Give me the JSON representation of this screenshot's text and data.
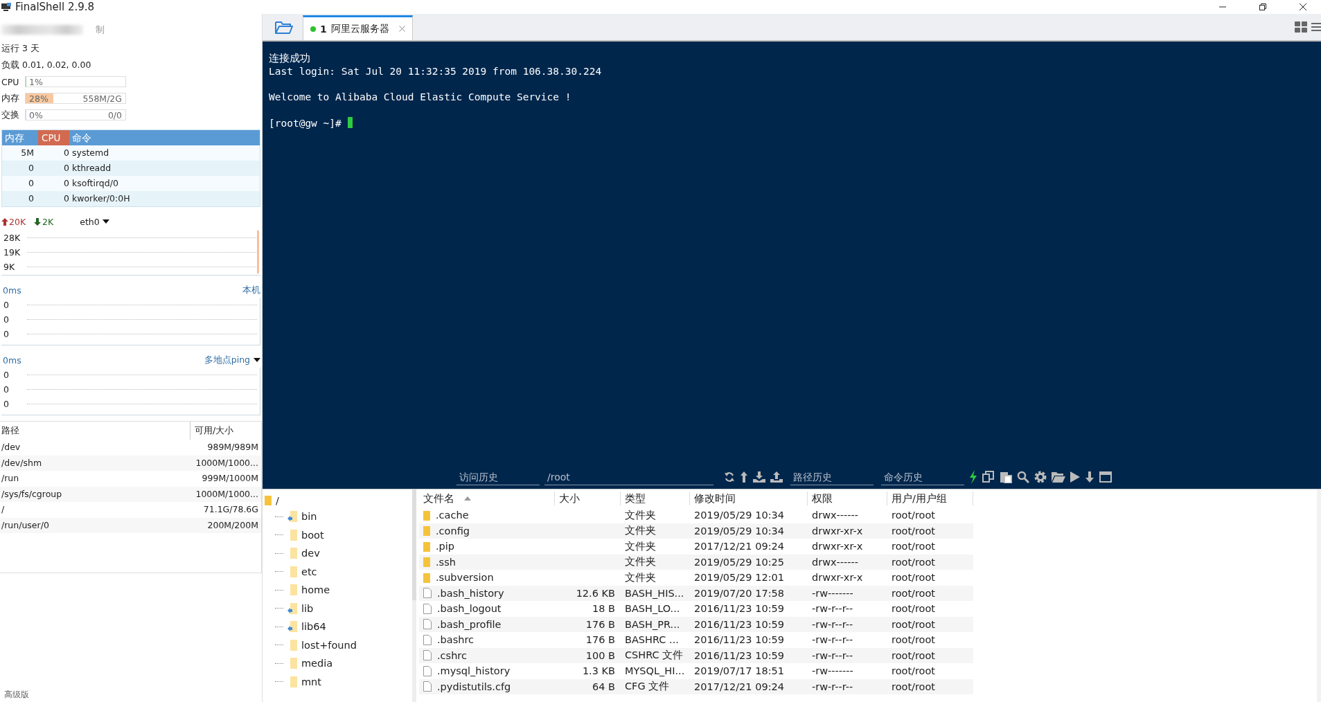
{
  "window": {
    "title": "FinalShell 2.9.8"
  },
  "sidebar": {
    "host_suffix": "制",
    "uptime": "运行 3 天",
    "load": "负载 0.01, 0.02, 0.00",
    "meters": [
      {
        "label": "CPU",
        "percent": "1%",
        "level": 0.01,
        "kind": "cpu"
      },
      {
        "label": "内存",
        "percent": "28%",
        "reading": "558M/2G",
        "level": 0.28,
        "kind": "mem"
      },
      {
        "label": "交换",
        "percent": "0%",
        "reading": "0/0",
        "level": 0,
        "kind": "swap"
      }
    ],
    "process_table": {
      "columns": [
        "内存",
        "CPU",
        "命令"
      ],
      "rows": [
        {
          "mem": "5M",
          "cpu": "0",
          "command": "systemd"
        },
        {
          "mem": "0",
          "cpu": "0",
          "command": "kthreadd"
        },
        {
          "mem": "0",
          "cpu": "0",
          "command": "ksoftirqd/0"
        },
        {
          "mem": "0",
          "cpu": "0",
          "command": "kworker/0:0H"
        }
      ]
    },
    "network": {
      "upload": "20K",
      "download": "2K",
      "interface": "eth0",
      "ticks": [
        "28K",
        "19K",
        "9K"
      ]
    },
    "ping_local": {
      "latency": "0ms",
      "target": "本机",
      "ticks": [
        "0",
        "0",
        "0"
      ]
    },
    "ping_multi": {
      "latency": "0ms",
      "target": "多地点ping",
      "ticks": [
        "0",
        "0",
        "0"
      ]
    },
    "disk_table": {
      "columns": [
        "路径",
        "可用/大小"
      ],
      "rows": [
        {
          "path": "/dev",
          "usage": "989M/989M"
        },
        {
          "path": "/dev/shm",
          "usage": "1000M/1000..."
        },
        {
          "path": "/run",
          "usage": "999M/1000M"
        },
        {
          "path": "/sys/fs/cgroup",
          "usage": "1000M/1000..."
        },
        {
          "path": "/",
          "usage": "71.1G/78.6G"
        },
        {
          "path": "/run/user/0",
          "usage": "200M/200M"
        }
      ]
    },
    "edition": "高级版"
  },
  "tabs": [
    {
      "index": "1",
      "label": "阿里云服务器",
      "selected": true,
      "connected": true
    }
  ],
  "terminal": {
    "paragraphs": [
      [
        "连接成功",
        "Last login: Sat Jul 20 11:32:35 2019 from 106.38.30.224"
      ],
      [
        "Welcome to Alibaba Cloud Elastic Compute Service !"
      ]
    ],
    "prompt": "[root@gw ~]# "
  },
  "toolbar": {
    "visit_history": {
      "placeholder": "访问历史"
    },
    "path": "/root",
    "path_history": {
      "placeholder": "路径历史"
    },
    "command_history": {
      "placeholder": "命令历史"
    }
  },
  "tree": {
    "root": "/",
    "items": [
      {
        "name": "bin",
        "link": true
      },
      {
        "name": "boot",
        "link": false
      },
      {
        "name": "dev",
        "link": false
      },
      {
        "name": "etc",
        "link": false
      },
      {
        "name": "home",
        "link": false
      },
      {
        "name": "lib",
        "link": true
      },
      {
        "name": "lib64",
        "link": true
      },
      {
        "name": "lost+found",
        "link": false
      },
      {
        "name": "media",
        "link": false
      },
      {
        "name": "mnt",
        "link": false
      }
    ]
  },
  "file_table": {
    "columns": [
      "文件名",
      "大小",
      "类型",
      "修改时间",
      "权限",
      "用户/用户组"
    ],
    "rows": [
      {
        "kind": "folder",
        "name": ".cache",
        "size": "",
        "type": "文件夹",
        "modified": "2019/05/29 10:34",
        "perm": "drwx------",
        "owner": "root/root"
      },
      {
        "kind": "folder",
        "name": ".config",
        "size": "",
        "type": "文件夹",
        "modified": "2019/05/29 10:34",
        "perm": "drwxr-xr-x",
        "owner": "root/root"
      },
      {
        "kind": "folder",
        "name": ".pip",
        "size": "",
        "type": "文件夹",
        "modified": "2017/12/21 09:24",
        "perm": "drwxr-xr-x",
        "owner": "root/root"
      },
      {
        "kind": "folder",
        "name": ".ssh",
        "size": "",
        "type": "文件夹",
        "modified": "2019/05/29 10:25",
        "perm": "drwx------",
        "owner": "root/root"
      },
      {
        "kind": "folder",
        "name": ".subversion",
        "size": "",
        "type": "文件夹",
        "modified": "2019/05/29 12:01",
        "perm": "drwxr-xr-x",
        "owner": "root/root"
      },
      {
        "kind": "file",
        "name": ".bash_history",
        "size": "12.6 KB",
        "type": "BASH_HIS...",
        "modified": "2019/07/20 17:58",
        "perm": "-rw-------",
        "owner": "root/root"
      },
      {
        "kind": "file",
        "name": ".bash_logout",
        "size": "18 B",
        "type": "BASH_LO...",
        "modified": "2016/11/23 10:59",
        "perm": "-rw-r--r--",
        "owner": "root/root"
      },
      {
        "kind": "file",
        "name": ".bash_profile",
        "size": "176 B",
        "type": "BASH_PR...",
        "modified": "2016/11/23 10:59",
        "perm": "-rw-r--r--",
        "owner": "root/root"
      },
      {
        "kind": "file",
        "name": ".bashrc",
        "size": "176 B",
        "type": "BASHRC ...",
        "modified": "2016/11/23 10:59",
        "perm": "-rw-r--r--",
        "owner": "root/root"
      },
      {
        "kind": "file",
        "name": ".cshrc",
        "size": "100 B",
        "type": "CSHRC 文件",
        "modified": "2016/11/23 10:59",
        "perm": "-rw-r--r--",
        "owner": "root/root"
      },
      {
        "kind": "file",
        "name": ".mysql_history",
        "size": "1.3 KB",
        "type": "MYSQL_HI...",
        "modified": "2019/07/17 18:51",
        "perm": "-rw-------",
        "owner": "root/root"
      },
      {
        "kind": "file",
        "name": ".pydistutils.cfg",
        "size": "64 B",
        "type": "CFG 文件",
        "modified": "2017/12/21 09:24",
        "perm": "-rw-r--r--",
        "owner": "root/root"
      }
    ]
  }
}
